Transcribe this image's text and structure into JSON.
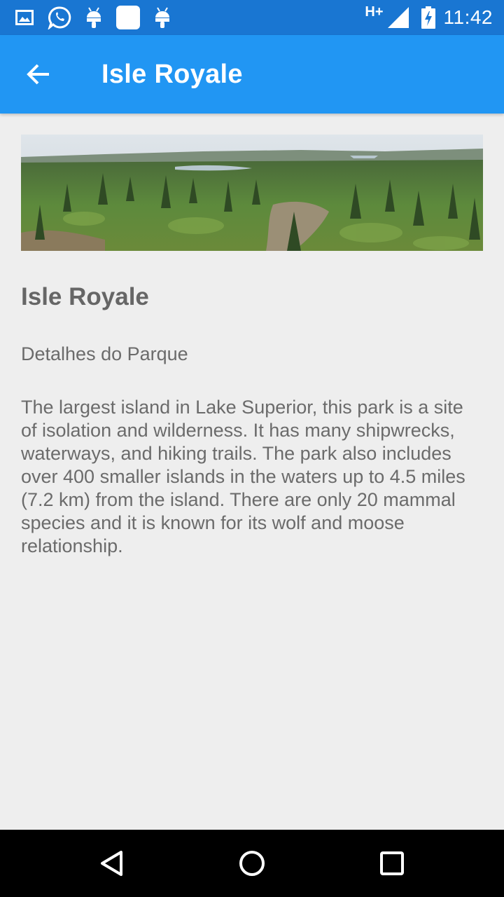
{
  "status_bar": {
    "icons": [
      "gallery-icon",
      "whatsapp-icon",
      "android-icon",
      "square-icon",
      "android-icon"
    ],
    "network": "H+",
    "time": "11:42"
  },
  "app_bar": {
    "back_icon": "arrow-back-icon",
    "title": "Isle Royale"
  },
  "park": {
    "image_alt": "Panoramic view of forested island landscape",
    "name": "Isle Royale",
    "subtitle": "Detalhes do Parque",
    "description": "The largest island in Lake Superior, this park is a site of isolation and wilderness. It has many shipwrecks, waterways, and hiking trails. The park also includes over 400 smaller islands in the waters up to 4.5 miles (7.2 km) from the island. There are only 20 mammal species and it is known for its wolf and moose relationship."
  },
  "nav_bar": {
    "buttons": [
      "back-triangle-icon",
      "home-circle-icon",
      "recents-square-icon"
    ]
  },
  "colors": {
    "status_bar": "#1976d2",
    "app_bar": "#2196f3",
    "background": "#eeeeee",
    "text": "#6b6b6b"
  }
}
